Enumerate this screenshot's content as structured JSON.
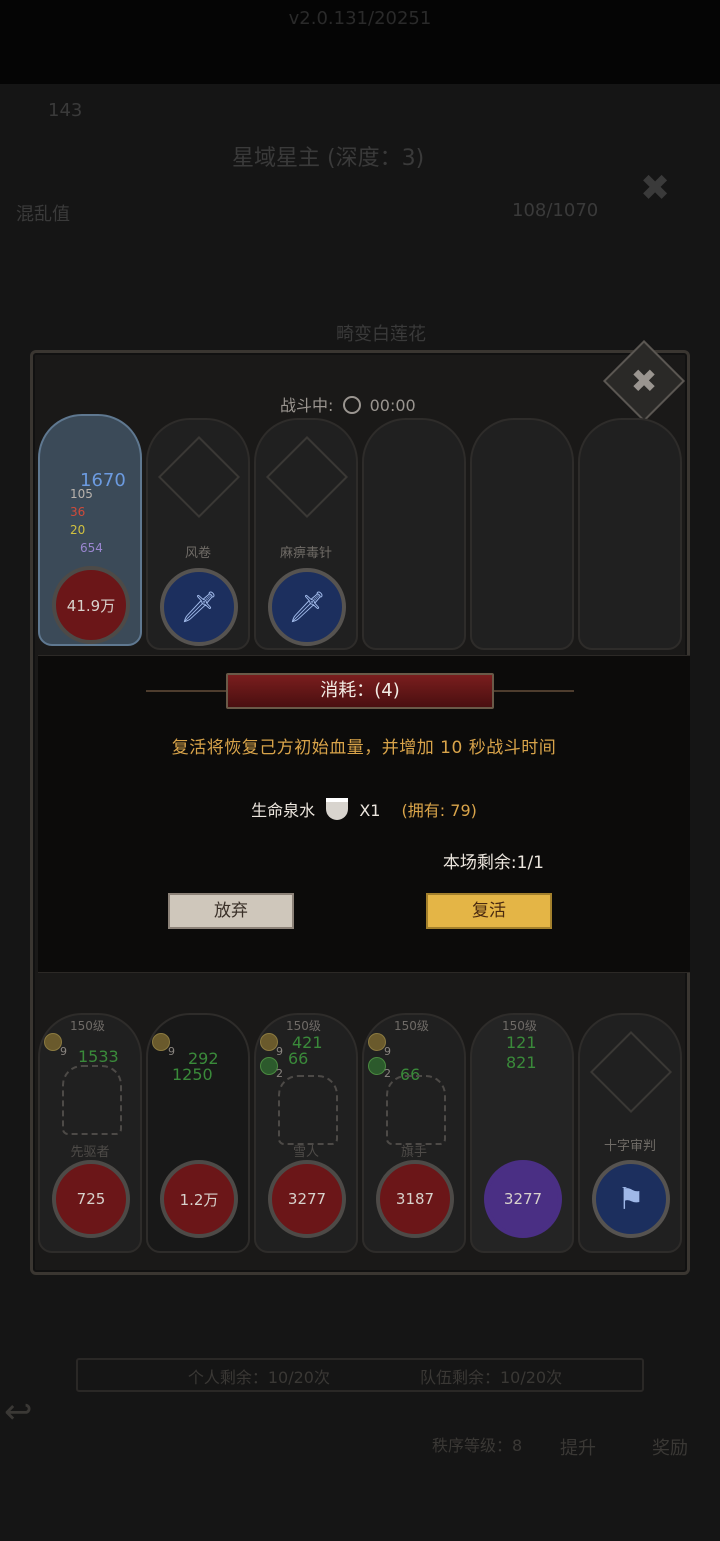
{
  "status": {
    "version": "v2.0.131/20251"
  },
  "background": {
    "currency_value": "143",
    "title": "星域星主 (深度：3)",
    "chaos_label": "混乱值",
    "chaos_value": "108/1070",
    "subtitle": "畸变白莲花"
  },
  "battle": {
    "status_label": "战斗中:",
    "timer": "00:00",
    "close_icon": "close-x-icon",
    "enemy_slots": [
      {
        "name": "",
        "hp": "41.9万",
        "buffs": [
          "1670",
          "105",
          "36",
          "20",
          "654"
        ],
        "active": true
      },
      {
        "name": "风卷",
        "icon": "sword-icon"
      },
      {
        "name": "麻痹毒针",
        "icon": "sword-icon"
      },
      {
        "name": ""
      },
      {
        "name": ""
      },
      {
        "name": ""
      }
    ]
  },
  "modal": {
    "header": "消耗：(4)",
    "description": "复活将恢复己方初始血量，并增加 10 秒战斗时间",
    "item_name": "生命泉水",
    "item_qty": "X1",
    "owned": "(拥有: 79)",
    "remaining": "本场剩余:1/1",
    "give_up_label": "放弃",
    "revive_label": "复活"
  },
  "team": [
    {
      "level": "150级",
      "name": "先驱者",
      "hp": "725",
      "badge": "9",
      "stat1": "1533"
    },
    {
      "level": "",
      "name": "",
      "hp": "1.2万",
      "badge": "9",
      "stat1": "292",
      "stat2": "1250"
    },
    {
      "level": "150级",
      "name": "雪人",
      "hp": "3277",
      "badge": "9",
      "badge2": "2",
      "stat1": "421",
      "stat2": "66"
    },
    {
      "level": "150级",
      "name": "旗手",
      "hp": "3187",
      "badge": "9",
      "badge2": "2",
      "stat1": "66"
    },
    {
      "level": "150级",
      "name": "",
      "hp": "3277",
      "badge": "9",
      "stat1": "121",
      "stat2": "821"
    },
    {
      "level": "",
      "name": "十字审判",
      "hp": ""
    }
  ],
  "bottom": {
    "personal_remaining": "个人剩余：10/20次",
    "team_remaining": "队伍剩余：10/20次",
    "order_level": "秩序等级：8",
    "upgrade": "提升",
    "reward": "奖励"
  },
  "colors": {
    "accent_gold": "#d9a44a",
    "header_red": "#7a1e1e",
    "revive_btn": "#e4b546"
  }
}
